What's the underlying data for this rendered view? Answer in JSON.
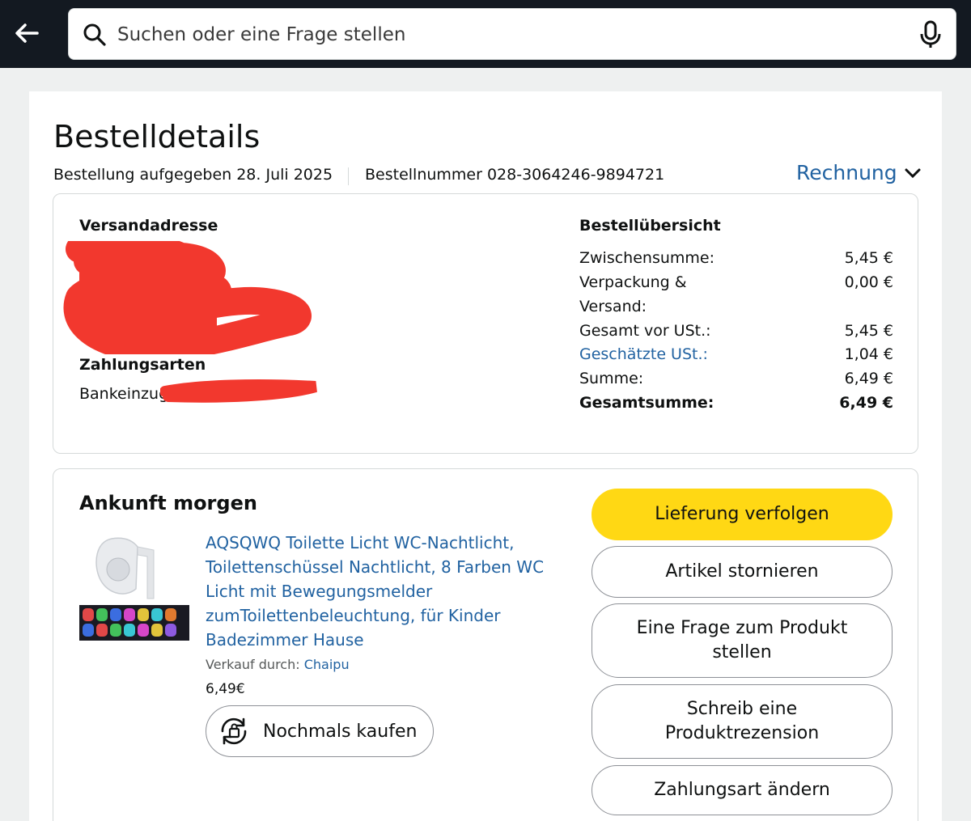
{
  "search": {
    "placeholder": "Suchen oder eine Frage stellen"
  },
  "page": {
    "title": "Bestelldetails",
    "order_date": "Bestellung aufgegeben 28. Juli 2025",
    "order_number": "Bestellnummer 028-3064246-9894721",
    "invoice_label": "Rechnung"
  },
  "address": {
    "label": "Versandadresse"
  },
  "payment": {
    "label": "Zahlungsarten",
    "value": "Bankeinzug"
  },
  "summary": {
    "title": "Bestellübersicht",
    "rows": [
      {
        "label": "Zwischensumme:",
        "value": "5,45 €"
      },
      {
        "label": "Verpackung & Versand:",
        "value": "0,00 €"
      },
      {
        "label": "Gesamt vor USt.:",
        "value": "5,45 €"
      },
      {
        "label": "Geschätzte USt.:",
        "value": "1,04 €"
      },
      {
        "label": "Summe:",
        "value": "6,49 €"
      },
      {
        "label": "Gesamtsumme:",
        "value": "6,49 €"
      }
    ]
  },
  "shipment": {
    "status": "Ankunft morgen",
    "product_title": "AQSQWQ Toilette Licht WC-Nachtlicht, Toilettenschüssel Nachtlicht, 8 Farben WC Licht mit Bewegungsmelder zumToilettenbeleuchtung, für Kinder Badezimmer Hause",
    "seller_prefix": "Verkauf durch:",
    "seller_name": "Chaipu",
    "price": "6,49€",
    "rebuy_label": "Nochmals kaufen"
  },
  "actions": {
    "track": "Lieferung verfolgen",
    "cancel": "Artikel stornieren",
    "ask": "Eine Frage zum Produkt stellen",
    "review": "Schreib eine Produktrezension",
    "change_payment": "Zahlungsart ändern"
  },
  "colors": {
    "topbar": "#131921",
    "link": "#2162a1",
    "primary_button": "#ffd814",
    "redaction": "#f2382e"
  },
  "icons": [
    "back-arrow-icon",
    "search-icon",
    "mic-icon",
    "chevron-down-icon",
    "rebuy-icon"
  ]
}
